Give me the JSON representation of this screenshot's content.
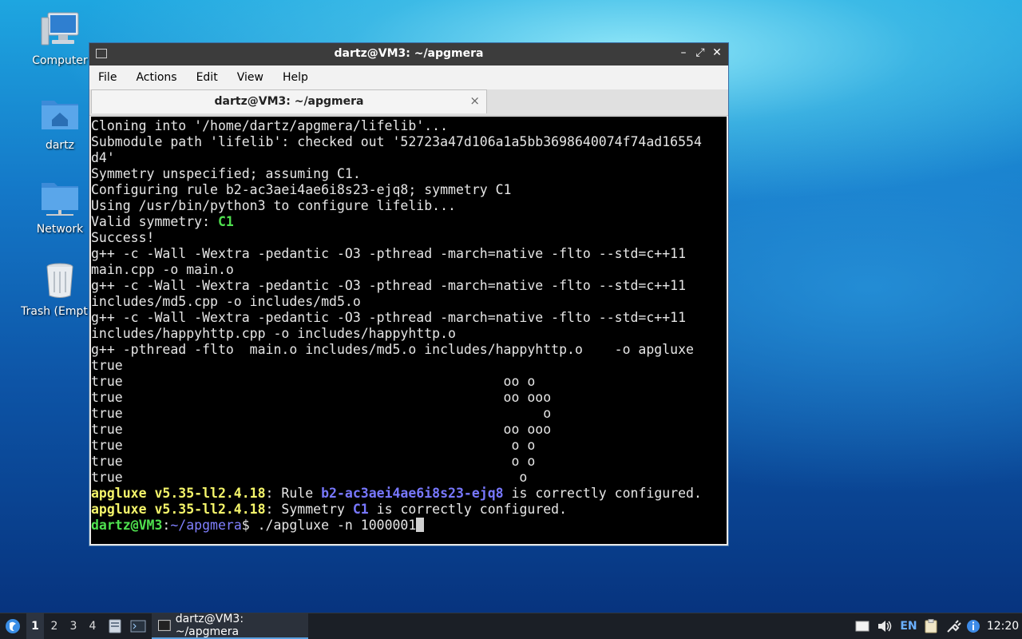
{
  "desktop": {
    "icons": [
      {
        "label": "Computer",
        "icon": "computer-icon"
      },
      {
        "label": "dartz",
        "icon": "home-folder-icon"
      },
      {
        "label": "Network",
        "icon": "network-folder-icon"
      },
      {
        "label": "Trash (Empt",
        "icon": "trash-icon"
      }
    ]
  },
  "window": {
    "title": "dartz@VM3: ~/apgmera",
    "menu": [
      "File",
      "Actions",
      "Edit",
      "View",
      "Help"
    ],
    "tab_title": "dartz@VM3: ~/apgmera",
    "tab_close": "×",
    "buttons": {
      "minimize": "–",
      "maximize": "⤢",
      "close": "✕"
    }
  },
  "terminal": {
    "lines": [
      "Cloning into '/home/dartz/apgmera/lifelib'...",
      "Submodule path 'lifelib': checked out '52723a47d106a1a5bb3698640074f74ad16554",
      "d4'",
      "Symmetry unspecified; assuming C1.",
      "Configuring rule b2-ac3aei4ae6i8s23-ejq8; symmetry C1",
      "Using /usr/bin/python3 to configure lifelib...",
      "Valid symmetry: ",
      "Success!",
      "g++ -c -Wall -Wextra -pedantic -O3 -pthread -march=native -flto --std=c++11",
      "main.cpp -o main.o",
      "g++ -c -Wall -Wextra -pedantic -O3 -pthread -march=native -flto --std=c++11",
      "includes/md5.cpp -o includes/md5.o",
      "g++ -c -Wall -Wextra -pedantic -O3 -pthread -march=native -flto --std=c++11",
      "includes/happyhttp.cpp -o includes/happyhttp.o",
      "g++ -pthread -flto  main.o includes/md5.o includes/happyhttp.o    -o apgluxe",
      "true",
      "true                                                oo o",
      "true                                                oo ooo",
      "true                                                     o",
      "true                                                oo ooo",
      "true                                                 o o",
      "true                                                 o o",
      "true                                                  o"
    ],
    "valid_symmetry_value": "C1",
    "config_lines": [
      {
        "prog": "apgluxe v5.35-ll2.4.18",
        "mid": ": Rule ",
        "value": "b2-ac3aei4ae6i8s23-ejq8",
        "tail": " is correctly configured."
      },
      {
        "prog": "apgluxe v5.35-ll2.4.18",
        "mid": ": Symmetry ",
        "value": "C1",
        "tail": " is correctly configured."
      }
    ],
    "prompt": {
      "user_host": "dartz@VM3",
      "sep": ":",
      "path": "~/apgmera",
      "symbol": "$",
      "command": " ./apgluxe -n 1000001"
    }
  },
  "taskbar": {
    "workspaces": [
      "1",
      "2",
      "3",
      "4"
    ],
    "task_title": "dartz@VM3: ~/apgmera",
    "language": "EN",
    "clock": "12:20"
  }
}
